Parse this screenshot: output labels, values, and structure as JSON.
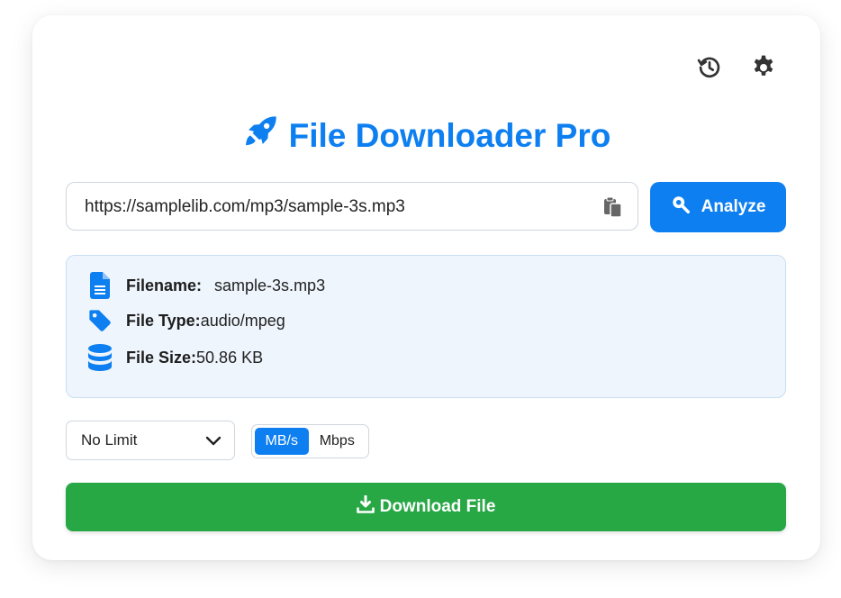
{
  "header": {
    "title": "File Downloader Pro",
    "title_icon": "rocket-icon",
    "history_icon": "history-icon",
    "settings_icon": "gear-icon"
  },
  "url_input": {
    "value": "https://samplelib.com/mp3/sample-3s.mp3",
    "paste_icon": "clipboard-icon"
  },
  "analyze_button": {
    "label": "Analyze",
    "icon": "search-icon"
  },
  "file_info": {
    "filename_label": "Filename:",
    "filename_value": "sample-3s.mp3",
    "filetype_label": "File Type:",
    "filetype_value": "audio/mpeg",
    "filesize_label": "File Size:",
    "filesize_value": "50.86 KB"
  },
  "speed_limit": {
    "selected": "No Limit"
  },
  "unit_toggle": {
    "options": [
      "MB/s",
      "Mbps"
    ],
    "selected": "MB/s"
  },
  "download_button": {
    "label": "Download File",
    "icon": "download-icon"
  },
  "colors": {
    "primary": "#0d7ff0",
    "success": "#28a745",
    "info_bg": "#eef5fd"
  }
}
